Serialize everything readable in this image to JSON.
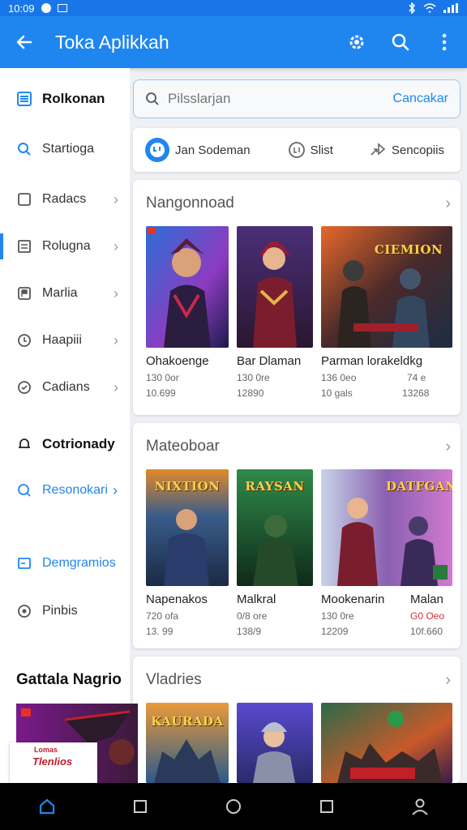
{
  "status_bar": {
    "time": "10:09"
  },
  "app_bar": {
    "title": "Toka Aplikkah"
  },
  "sidebar": {
    "items": [
      {
        "label": "Rolkonan",
        "icon": "list-icon"
      },
      {
        "label": "Startioga",
        "icon": "search-icon"
      },
      {
        "label": "Radacs",
        "icon": "folder-icon"
      },
      {
        "label": "Rolugna",
        "icon": "grid-icon"
      },
      {
        "label": "Marlia",
        "icon": "flag-icon"
      },
      {
        "label": "Haapiii",
        "icon": "shield-icon"
      },
      {
        "label": "Cadians",
        "icon": "badge-icon"
      }
    ],
    "section2": [
      {
        "label": "Cotrionady",
        "icon": "bell-icon"
      },
      {
        "label": "Resonokari",
        "icon": "search-icon"
      },
      {
        "label": "Demgramios",
        "icon": "screen-icon"
      },
      {
        "label": "Pinbis",
        "icon": "coin-icon"
      }
    ],
    "bottom_heading": "Gattala Nagrio"
  },
  "search": {
    "placeholder": "Pilsslarjan",
    "cancel_label": "Cancakar"
  },
  "filters": [
    {
      "label": "Jan Sodeman",
      "icon": "chat-icon"
    },
    {
      "label": "Slist",
      "icon": "clock-icon"
    },
    {
      "label": "Sencopiis",
      "icon": "share-icon"
    }
  ],
  "sections": [
    {
      "title": "Nangonnoad",
      "games": [
        {
          "name": "Ohakoenge",
          "meta1": "130 0or",
          "meta2": "10.699"
        },
        {
          "name": "Bar Dlaman",
          "meta1": "130 0re",
          "meta2": "12890"
        },
        {
          "name": "Parman lorakeldkg",
          "meta1": "136 0eo",
          "meta2": "10 gals",
          "meta3": "74 e",
          "meta4": "13268",
          "cover_title": "CIEMION"
        }
      ]
    },
    {
      "title": "Mateoboar",
      "games": [
        {
          "name": "Napenakos",
          "meta1": "720 ofa",
          "meta2": "13. 99",
          "cover_title": "NIXTION"
        },
        {
          "name": "Malkral",
          "meta1": "0/8 ore",
          "meta2": "138/9",
          "cover_title": "RAYSAN"
        },
        {
          "name": "Mookenarin",
          "meta1": "130 0re",
          "meta2": "12209",
          "name2": "Malan",
          "meta3": "G0 Oeo",
          "meta4": "10f.660",
          "cover_title": "DATFGAN"
        }
      ]
    },
    {
      "title": "Vladries",
      "games": [
        {
          "cover_title": ""
        },
        {
          "cover_title": "KAURADA"
        },
        {
          "cover_title": ""
        },
        {
          "cover_title": ""
        }
      ]
    }
  ],
  "promo": {
    "text": "Tlenlios",
    "badge": "Lomas"
  },
  "colors": {
    "primary": "#1f86f0",
    "status_bar": "#1976e8",
    "nav_bg": "#000000"
  }
}
